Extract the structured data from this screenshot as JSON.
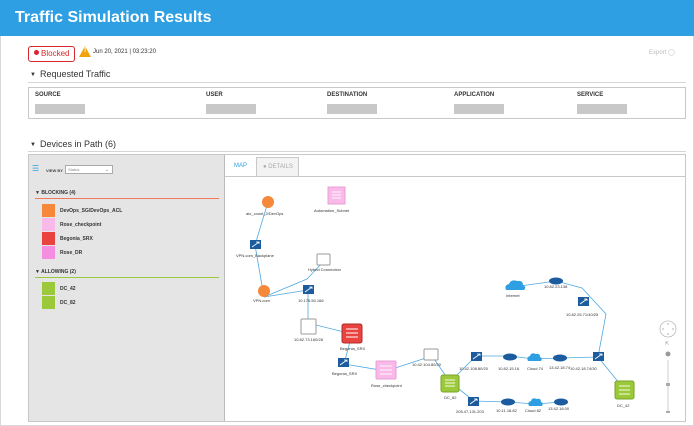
{
  "title": "Traffic Simulation Results",
  "status": {
    "label": "Blocked",
    "warning_glyph": "!",
    "timestamp": "Jun 20, 2021 | 03:23:20"
  },
  "export_label": "Export",
  "requested": {
    "heading": "Requested Traffic",
    "columns": [
      "SOURCE",
      "USER",
      "DESTINATION",
      "APPLICATION",
      "SERVICE"
    ]
  },
  "devices": {
    "heading": "Devices in Path (6)",
    "view_by_label": "VIEW BY",
    "view_by_value": "Status",
    "groups": [
      {
        "name": "BLOCKING (4)",
        "color": "#f07a5a",
        "items": [
          {
            "label": "DevOps_SG/DevOps_ACL",
            "color": "#f5883a"
          },
          {
            "label": "Rose_checkpoint",
            "color": "#f9b9e9"
          },
          {
            "label": "Begonia_SRX",
            "color": "#e8433e"
          },
          {
            "label": "Rose_DR",
            "color": "#f58ee0"
          }
        ]
      },
      {
        "name": "ALLOWING (2)",
        "color": "#9bc93a",
        "items": [
          {
            "label": "DC_42",
            "color": "#9bc93a"
          },
          {
            "label": "DC_82",
            "color": "#9bc93a"
          }
        ]
      }
    ]
  },
  "tabs": {
    "map": "MAP",
    "details": "DETAILS"
  },
  "map_labels": {
    "devops": "aio_count_2/DevOps",
    "automation": "Automation_Subnet",
    "vpn_backplane": "VPN.com_Backplane",
    "hybrid": "Hybrid Connection",
    "vpncom": "VPN.com",
    "ip_176": "10.176.50.166",
    "ip_8273": "10.82.73.160/28",
    "begonia1": "Begonia_SRX",
    "begonia2": "Begonia_SRX",
    "rose": "Rose_checkpoint",
    "ip_42104": "10.42.104.80/20",
    "ip_42108": "10.42.108.80/20",
    "ip_8215": "10.82.15.16",
    "cloud74": "Cloud 74",
    "ip_1342": "13.42.18.74",
    "ip_4218": "10.42.18.74/30",
    "dc42": "DC_42",
    "dc82": "DC_82",
    "ip_2054": "205.47.131.203",
    "ip_1211": "10.11.18.82",
    "cloud82": "Cloud 82",
    "ip_1342b": "13.42.18.00",
    "internet": "Internet",
    "ip_8223": "10.82.23.138",
    "ip_8225": "10.82.25.71/40/25"
  },
  "colors": {
    "accent": "#2d9fe2",
    "blocked_red": "#d9262c",
    "warning": "#f3a30b",
    "orange": "#f5883a",
    "pink_light": "#f9b9e9",
    "red": "#e8433e",
    "green": "#9bc93a"
  }
}
